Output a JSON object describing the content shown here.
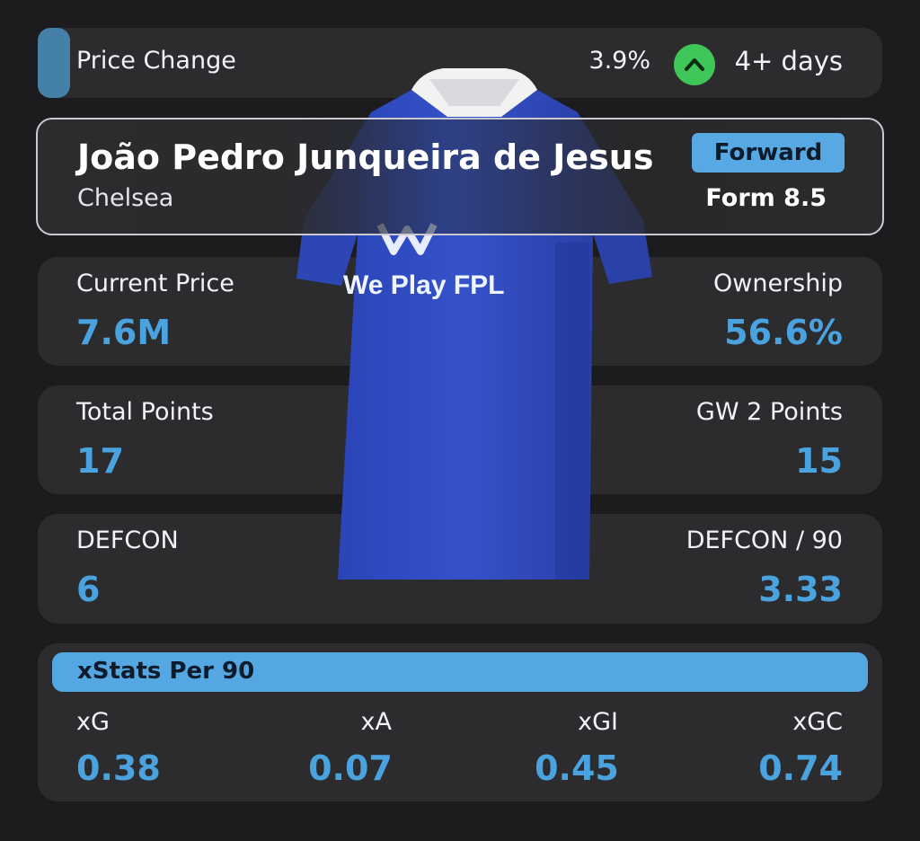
{
  "price_change": {
    "label": "Price Change",
    "percent": "3.9%",
    "direction_icon": "chevron-up-icon",
    "timeframe": "4+ days"
  },
  "player": {
    "name": "João Pedro Junqueira de Jesus",
    "team": "Chelsea",
    "position": "Forward",
    "form": "Form 8.5"
  },
  "shirt": {
    "sponsor_text": "We Play FPL"
  },
  "stats": {
    "current_price": {
      "label": "Current Price",
      "value": "7.6M"
    },
    "ownership": {
      "label": "Ownership",
      "value": "56.6%"
    },
    "total_points": {
      "label": "Total Points",
      "value": "17"
    },
    "gw_points": {
      "label": "GW 2 Points",
      "value": "15"
    },
    "defcon": {
      "label": "DEFCON",
      "value": "6"
    },
    "defcon_per_90": {
      "label": "DEFCON / 90",
      "value": "3.33"
    }
  },
  "xstats": {
    "title": "xStats Per 90",
    "items": [
      {
        "label": "xG",
        "value": "0.38"
      },
      {
        "label": "xA",
        "value": "0.07"
      },
      {
        "label": "xGI",
        "value": "0.45"
      },
      {
        "label": "xGC",
        "value": "0.74"
      }
    ]
  },
  "colors": {
    "accent_blue": "#4aa3df",
    "price_up_green": "#3ec659",
    "card_bg": "#2c2c2e",
    "page_bg": "#1c1c1e"
  }
}
